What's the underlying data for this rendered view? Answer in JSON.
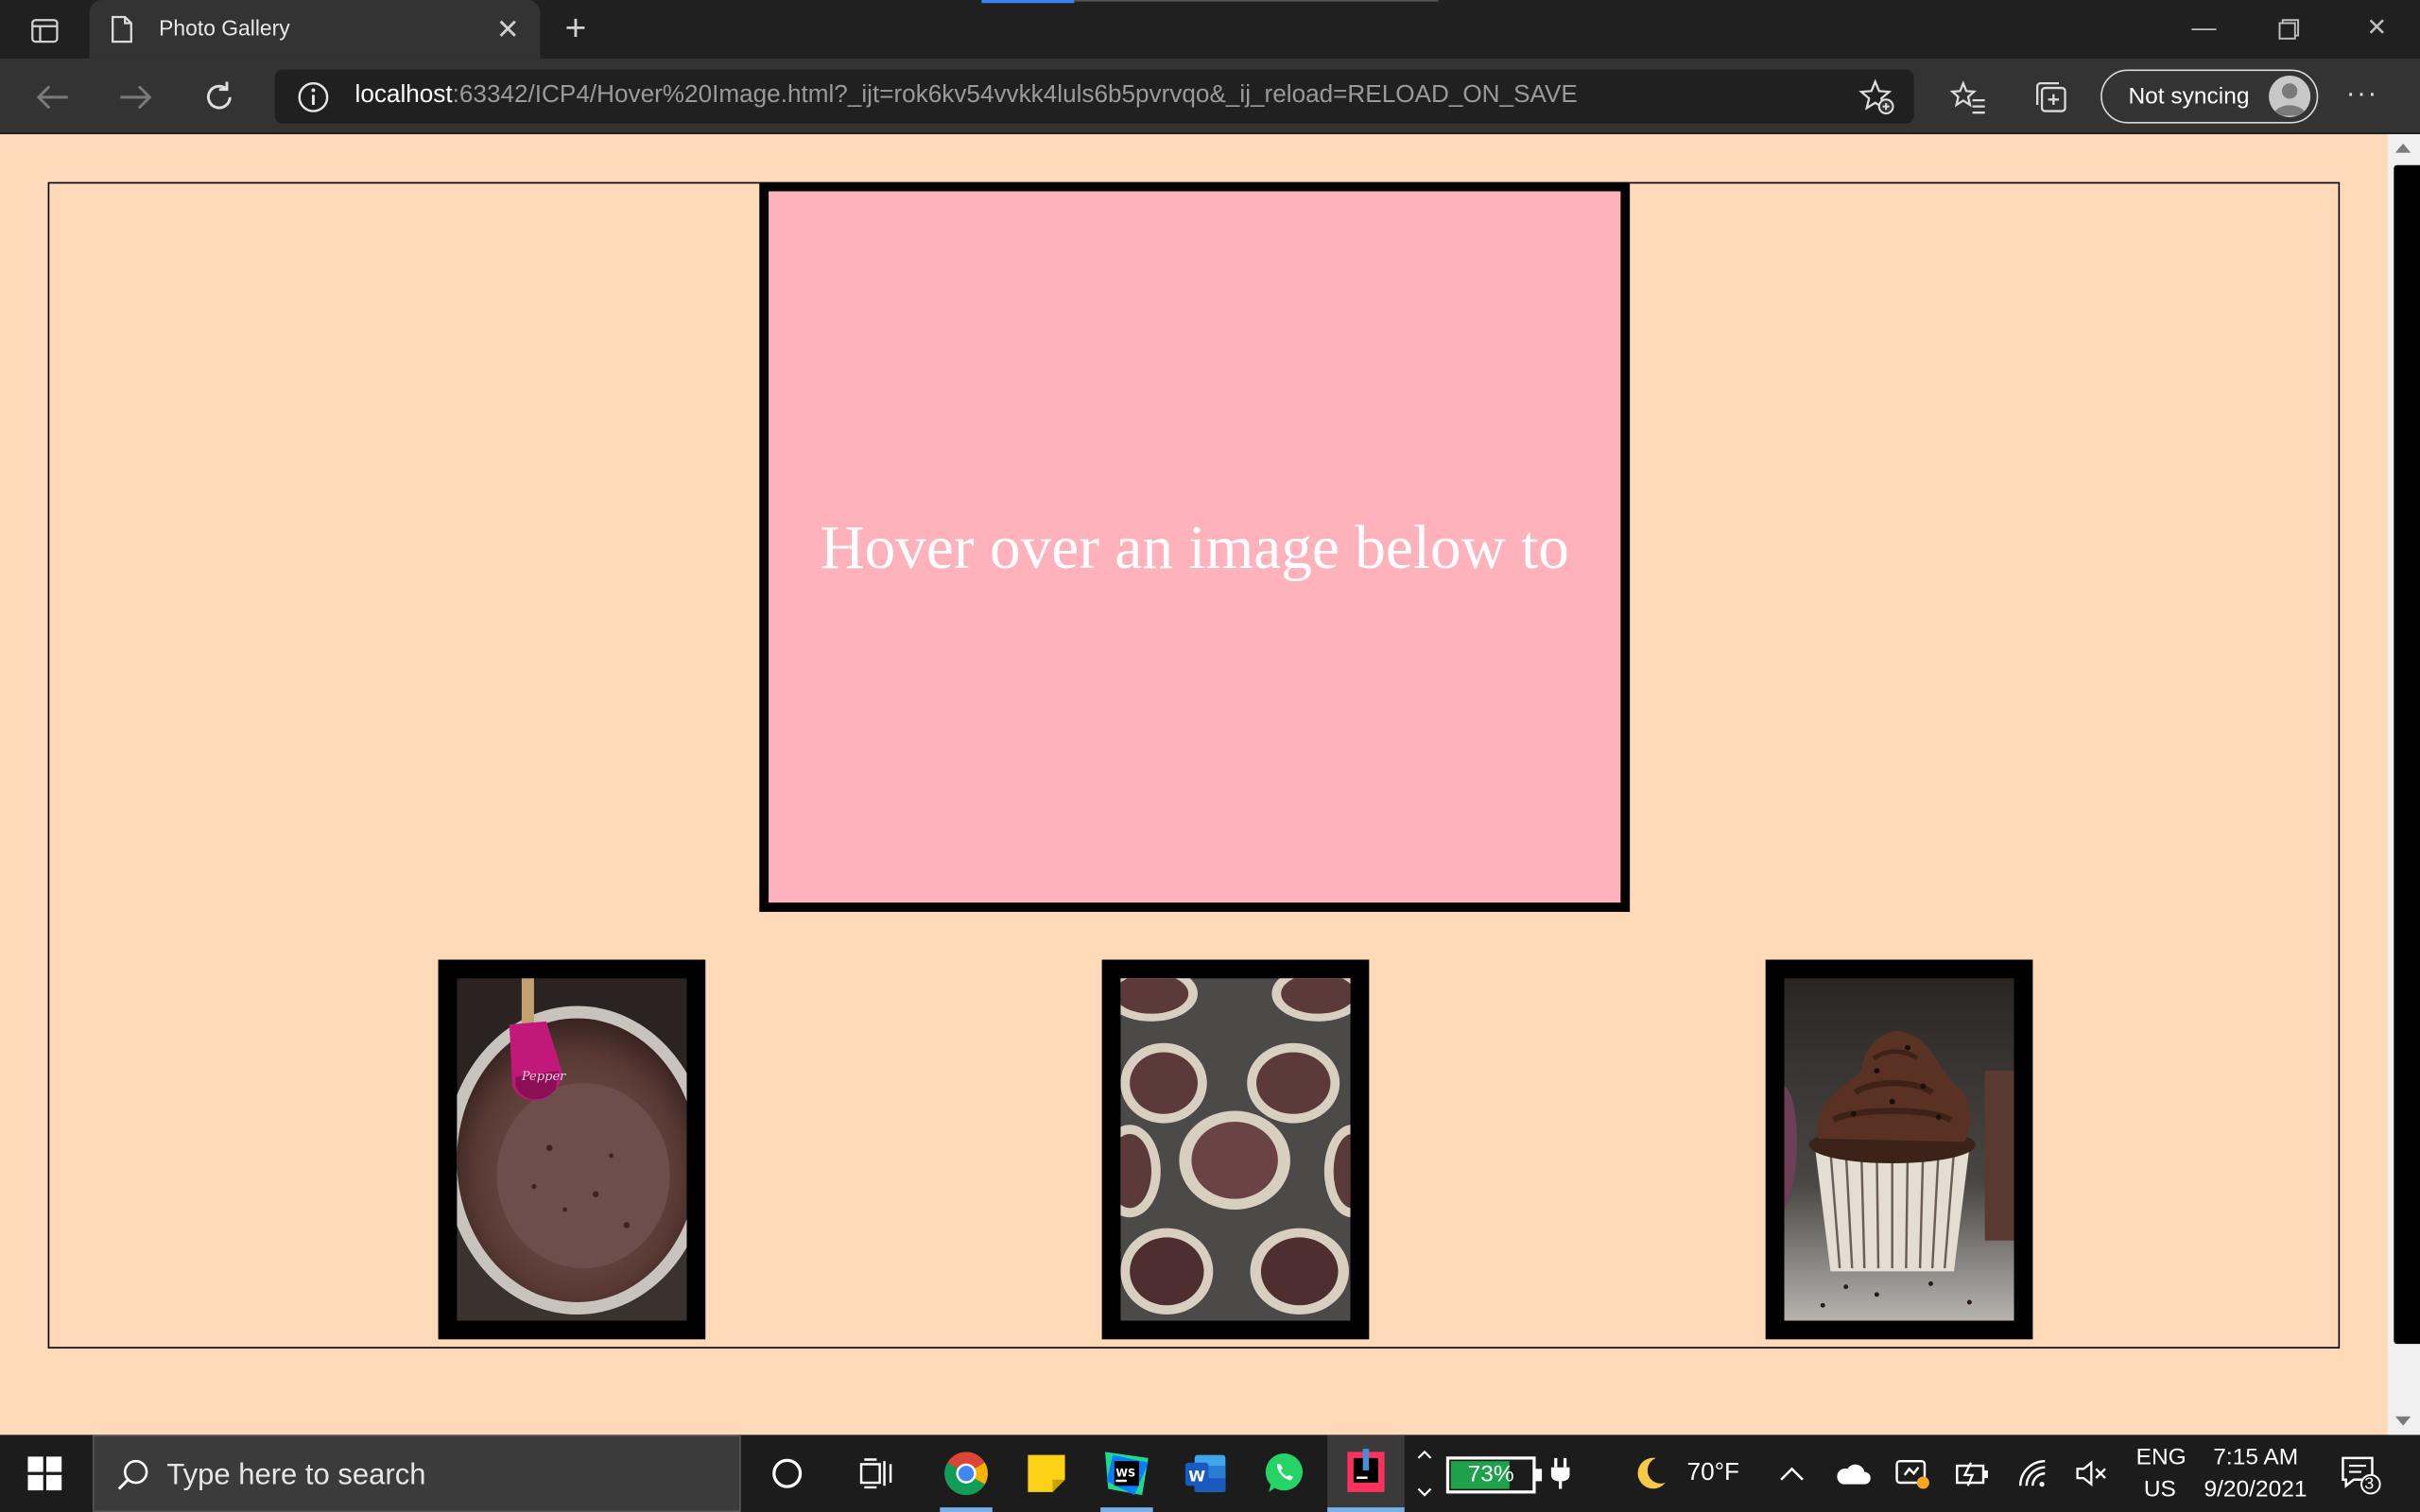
{
  "browser": {
    "tab_title": "Photo Gallery",
    "url_host": "localhost",
    "url_rest": ":63342/ICP4/Hover%20Image.html?_ijt=rok6kv54vvkk4luls6b5pvrvqo&_ij_reload=RELOAD_ON_SAVE",
    "sync_label": "Not syncing"
  },
  "page": {
    "main_caption": "Hover over an image below to",
    "background_color": "#ffdab9",
    "main_box_color": "#ffb1bc",
    "thumbnails": [
      {
        "icon": "chocolate-batter-bowl"
      },
      {
        "icon": "cupcake-liners-in-tin"
      },
      {
        "icon": "chocolate-cupcake-frosted"
      }
    ]
  },
  "taskbar": {
    "search_placeholder": "Type here to search",
    "battery_percent": "73%",
    "battery_level": 0.73,
    "weather": "70°F",
    "language_top": "ENG",
    "language_bottom": "US",
    "time": "7:15 AM",
    "date": "9/20/2021",
    "notification_count": "3"
  }
}
